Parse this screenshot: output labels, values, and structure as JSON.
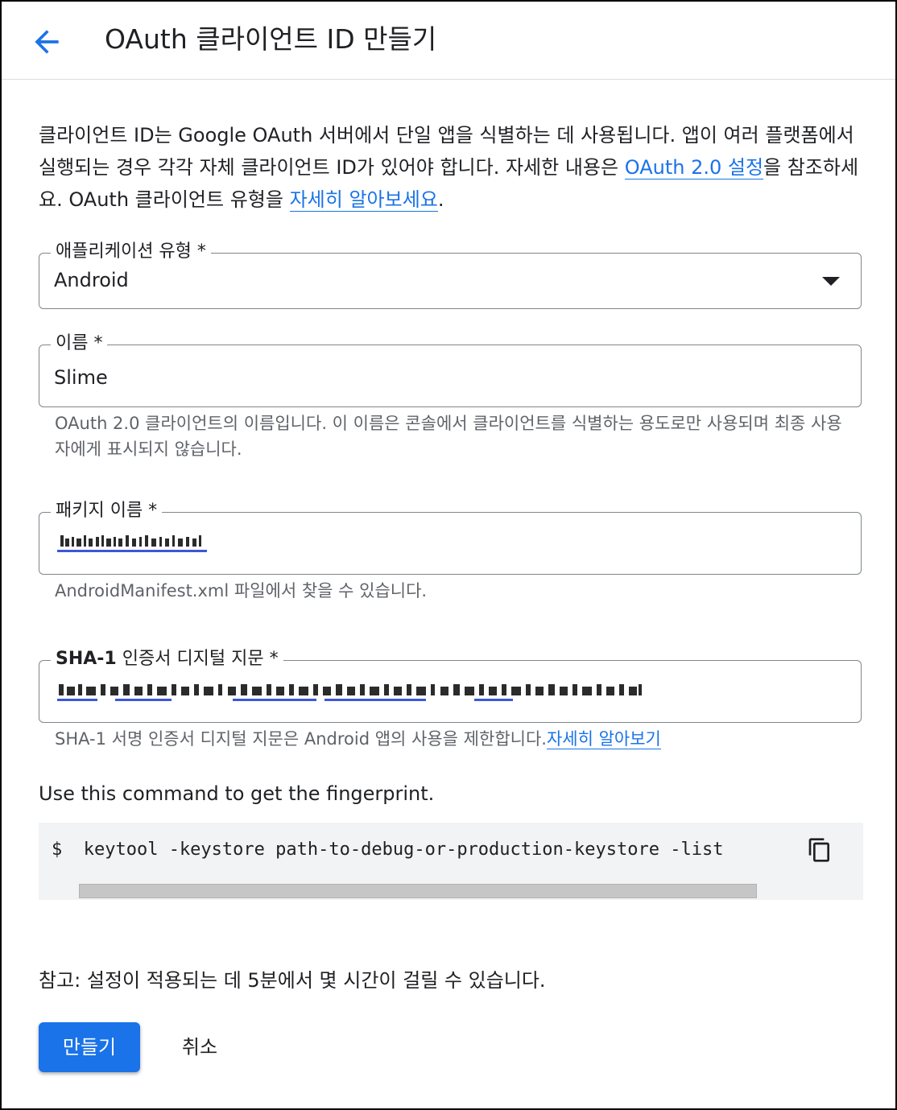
{
  "header": {
    "title": "OAuth 클라이언트 ID 만들기",
    "back_icon": "arrow-back-icon"
  },
  "intro": {
    "text_before_link1": "클라이언트 ID는 Google OAuth 서버에서 단일 앱을 식별하는 데 사용됩니다. 앱이 여러 플랫폼에서 실행되는 경우 각각 자체 클라이언트 ID가 있어야 합니다. 자세한 내용은 ",
    "link1": "OAuth 2.0 설정",
    "text_between": "을 참조하세요. OAuth 클라이언트 유형을 ",
    "link2": "자세히 알아보세요",
    "text_after": "."
  },
  "app_type": {
    "label": "애플리케이션 유형 *",
    "value": "Android",
    "icon": "dropdown-arrow-icon"
  },
  "name_field": {
    "label": "이름 *",
    "value": "Slime",
    "hint": "OAuth 2.0 클라이언트의 이름입니다. 이 이름은 콘솔에서 클라이언트를 식별하는 용도로만 사용되며 최종 사용자에게 표시되지 않습니다."
  },
  "package_field": {
    "label": "패키지 이름 *",
    "hint": "AndroidManifest.xml 파일에서 찾을 수 있습니다."
  },
  "sha1_field": {
    "label_bold": "SHA-1",
    "label_rest": " 인증서 디지털 지문 *",
    "hint": "SHA-1 서명 인증서 디지털 지문은 Android 앱의 사용을 제한합니다.",
    "hint_link": "자세히 알아보기"
  },
  "command": {
    "label": "Use this command to get the fingerprint.",
    "code": "$  keytool -keystore path-to-debug-or-production-keystore -list",
    "copy_icon": "copy-icon"
  },
  "note": "참고: 설정이 적용되는 데 5분에서 몇 시간이 걸릴 수 있습니다.",
  "buttons": {
    "create": "만들기",
    "cancel": "취소"
  },
  "colors": {
    "accent": "#1a73e8",
    "outline": "#80868b",
    "hint": "#5f6368",
    "code_bg": "#f1f3f4"
  }
}
